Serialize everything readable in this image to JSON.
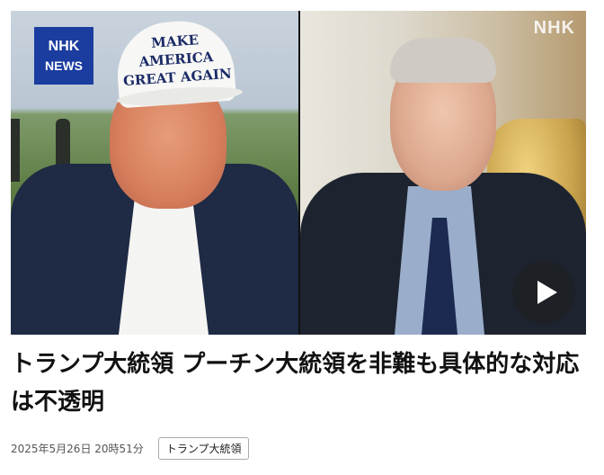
{
  "video": {
    "badge_line1": "NHK",
    "badge_line2": "NEWS",
    "corner_logo": "NHK",
    "cap_line1": "MAKE AMERICA",
    "cap_line2": "GREAT AGAIN",
    "play_icon": "play-icon"
  },
  "article": {
    "headline": "トランプ大統領 プーチン大統領を非難も具体的な対応は不透明",
    "date": "2025年5月26日 20時51分",
    "tag": "トランプ大統領"
  }
}
